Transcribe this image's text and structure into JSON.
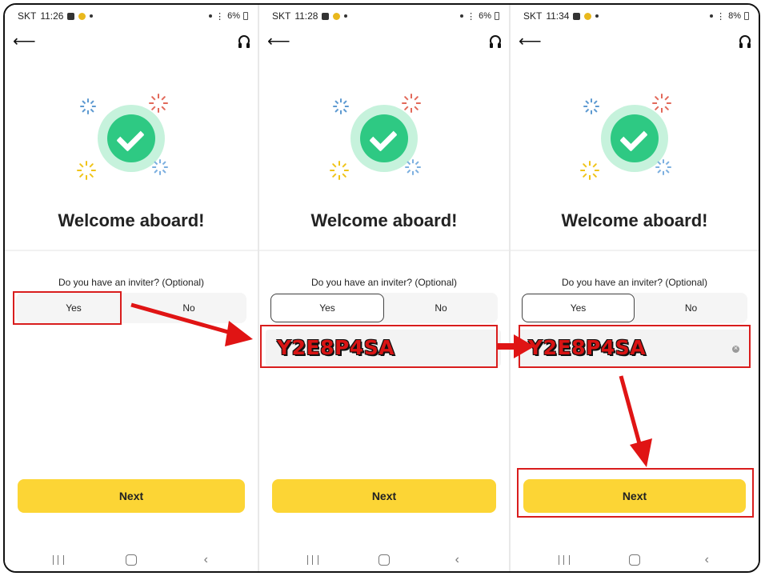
{
  "panels": [
    {
      "status": {
        "carrier": "SKT",
        "time": "11:26",
        "battery": "6%"
      },
      "title": "Welcome aboard!",
      "question": "Do you have an inviter? (Optional)",
      "yes_label": "Yes",
      "no_label": "No",
      "next_label": "Next"
    },
    {
      "status": {
        "carrier": "SKT",
        "time": "11:28",
        "battery": "6%"
      },
      "title": "Welcome aboard!",
      "question": "Do you have an inviter? (Optional)",
      "yes_label": "Yes",
      "no_label": "No",
      "code_value": "Y2E8P4SA",
      "next_label": "Next"
    },
    {
      "status": {
        "carrier": "SKT",
        "time": "11:34",
        "battery": "8%"
      },
      "title": "Welcome aboard!",
      "question": "Do you have an inviter? (Optional)",
      "yes_label": "Yes",
      "no_label": "No",
      "code_value": "Y2E8P4SA",
      "next_label": "Next"
    }
  ],
  "colors": {
    "accent_yellow": "#fcd535",
    "success_green": "#2ec983",
    "annotation_red": "#d91d1d"
  },
  "icons": [
    "back-arrow-icon",
    "headset-icon",
    "check-icon",
    "clear-icon",
    "nav-recent-icon",
    "nav-home-icon",
    "nav-back-icon"
  ]
}
